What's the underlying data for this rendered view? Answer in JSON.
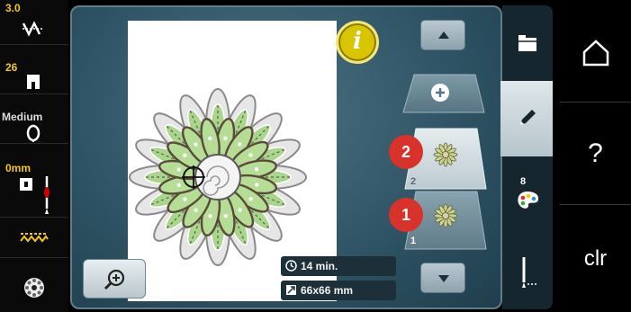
{
  "status_column": {
    "stitch_width": "3.0",
    "presser_foot": "26",
    "thread_tension": "Medium",
    "needle_position": "0mm"
  },
  "canvas": {
    "info_button_label": "i",
    "sewing_time": "14 min.",
    "design_size": "66x66 mm"
  },
  "layers": {
    "items": [
      {
        "number": "2",
        "badge": "2"
      },
      {
        "number": "1",
        "badge": "1"
      }
    ]
  },
  "tabs": {
    "color_count": "8"
  },
  "right_column": {
    "help_label": "?",
    "clear_label": "clr"
  },
  "icons": [
    "stitch-width-icon",
    "presser-foot-icon",
    "tension-icon",
    "needle-position-icon",
    "feed-dog-icon",
    "bobbin-icon",
    "zoom-in-icon",
    "clock-icon",
    "size-icon",
    "arrow-up-icon",
    "arrow-down-icon",
    "plus-icon",
    "folder-icon",
    "pencil-icon",
    "palette-icon",
    "embroider-icon",
    "home-icon"
  ],
  "colors": {
    "accent_yellow": "#f5c518",
    "badge_red": "#d8322a",
    "frame_blue": "#2f5566"
  }
}
